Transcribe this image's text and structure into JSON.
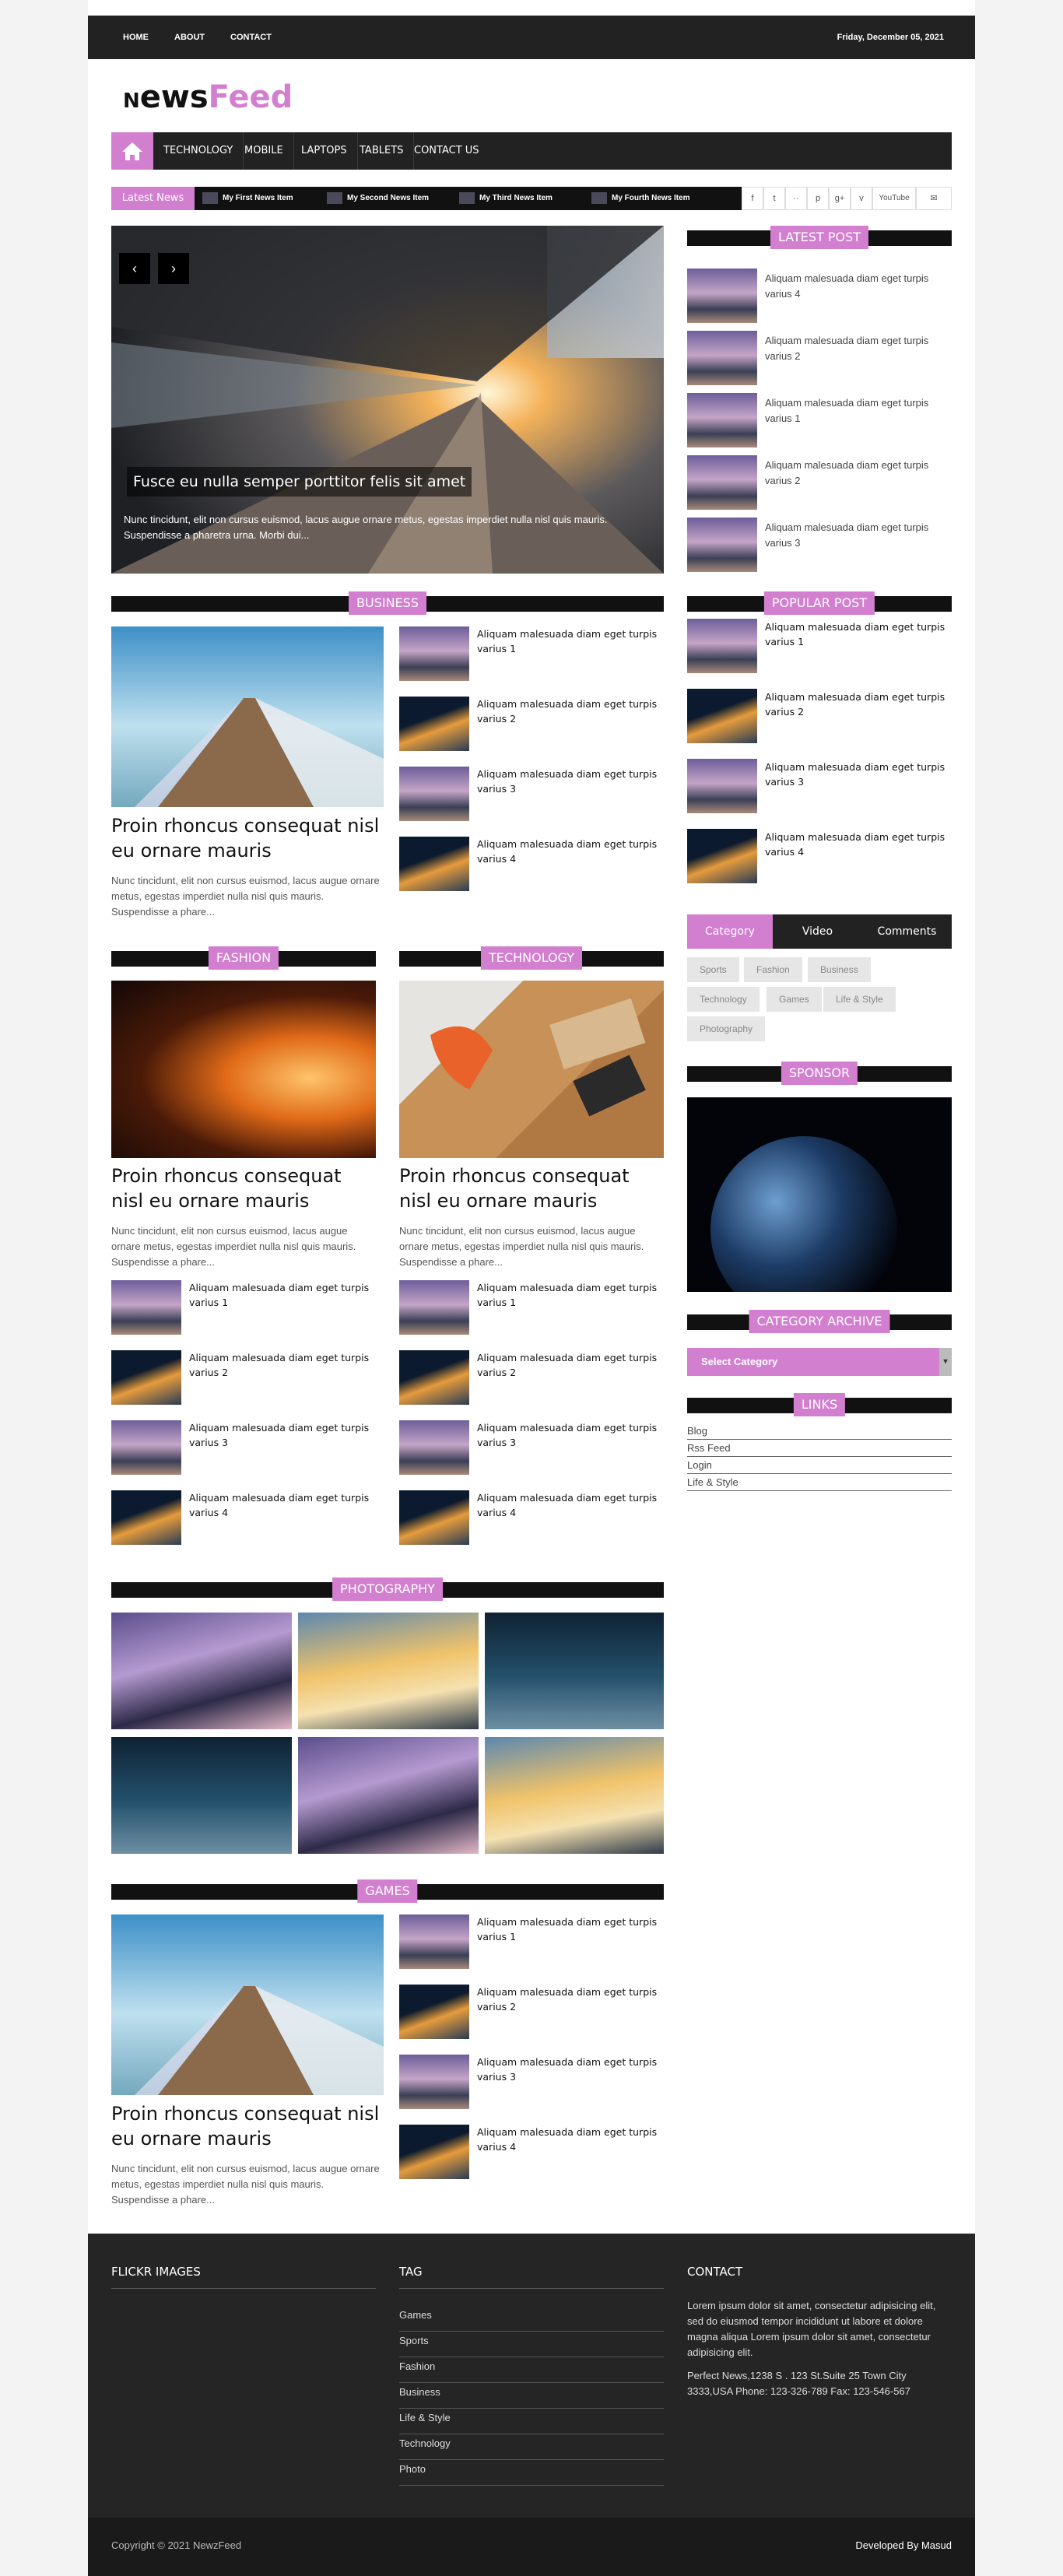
{
  "topnav": {
    "home": "HOME",
    "about": "ABOUT",
    "contact": "CONTACT",
    "date": "Friday, December 05, 2021"
  },
  "logo": {
    "n": "N",
    "news": "ews",
    "feed": "Feed"
  },
  "mainnav": [
    "TECHNOLOGY",
    "MOBILE",
    "LAPTOPS",
    "TABLETS",
    "CONTACT US"
  ],
  "ticker": {
    "label": "Latest News",
    "items": [
      "My First News Item",
      "My Second News Item",
      "My Third News Item",
      "My Fourth News Item"
    ]
  },
  "social": [
    "f",
    "t",
    "··",
    "p",
    "g+",
    "v",
    "YouTube",
    "✉"
  ],
  "slider": {
    "title": "Fusce eu nulla semper porttitor felis sit amet",
    "desc": "Nunc tincidunt, elit non cursus euismod, lacus augue ornare metus, egestas imperdiet nulla nisl quis mauris. Suspendisse a pharetra urna. Morbi dui..."
  },
  "sections": {
    "business": "BUSINESS",
    "fashion": "FASHION",
    "technology": "TECHNOLOGY",
    "photography": "PHOTOGRAPHY",
    "games": "GAMES"
  },
  "article": {
    "title": "Proin rhoncus consequat nisl eu ornare mauris",
    "desc": "Nunc tincidunt, elit non cursus euismod, lacus augue ornare metus, egestas imperdiet nulla nisl quis mauris. Suspendisse a phare..."
  },
  "small": [
    "Aliquam malesuada diam eget turpis varius 1",
    "Aliquam malesuada diam eget turpis varius 2",
    "Aliquam malesuada diam eget turpis varius 3",
    "Aliquam malesuada diam eget turpis varius 4"
  ],
  "sidebar": {
    "latest_title": "LATEST POST",
    "latest": [
      "Aliquam malesuada diam eget turpis varius 4",
      "Aliquam malesuada diam eget turpis varius 2",
      "Aliquam malesuada diam eget turpis varius 1",
      "Aliquam malesuada diam eget turpis varius 2",
      "Aliquam malesuada diam eget turpis varius 3"
    ],
    "popular_title": "POPULAR POST",
    "tabs": [
      "Category",
      "Video",
      "Comments"
    ],
    "categories": [
      "Sports",
      "Fashion",
      "Business",
      "Technology",
      "Games",
      "Life & Style",
      "Photography"
    ],
    "sponsor_title": "SPONSOR",
    "archive_title": "CATEGORY ARCHIVE",
    "select": "Select Category",
    "links_title": "LINKS",
    "links": [
      "Blog",
      "Rss Feed",
      "Login",
      "Life & Style"
    ]
  },
  "footer": {
    "flickr": "FLICKR IMAGES",
    "tag": "TAG",
    "contact": "CONTACT",
    "tags": [
      "Games",
      "Sports",
      "Fashion",
      "Business",
      "Life & Style",
      "Technology",
      "Photo"
    ],
    "contact_text": "Lorem ipsum dolor sit amet, consectetur adipisicing elit, sed do eiusmod tempor incididunt ut labore et dolore magna aliqua Lorem ipsum dolor sit amet, consectetur adipisicing elit.",
    "address": "Perfect News,1238 S . 123 St.Suite 25 Town City 3333,USA Phone: 123-326-789 Fax: 123-546-567",
    "copyright": "Copyright © 2021 NewzFeed",
    "dev": "Developed By Masud"
  },
  "colors": {
    "accent": "#d37fd0",
    "dark": "#222222"
  }
}
